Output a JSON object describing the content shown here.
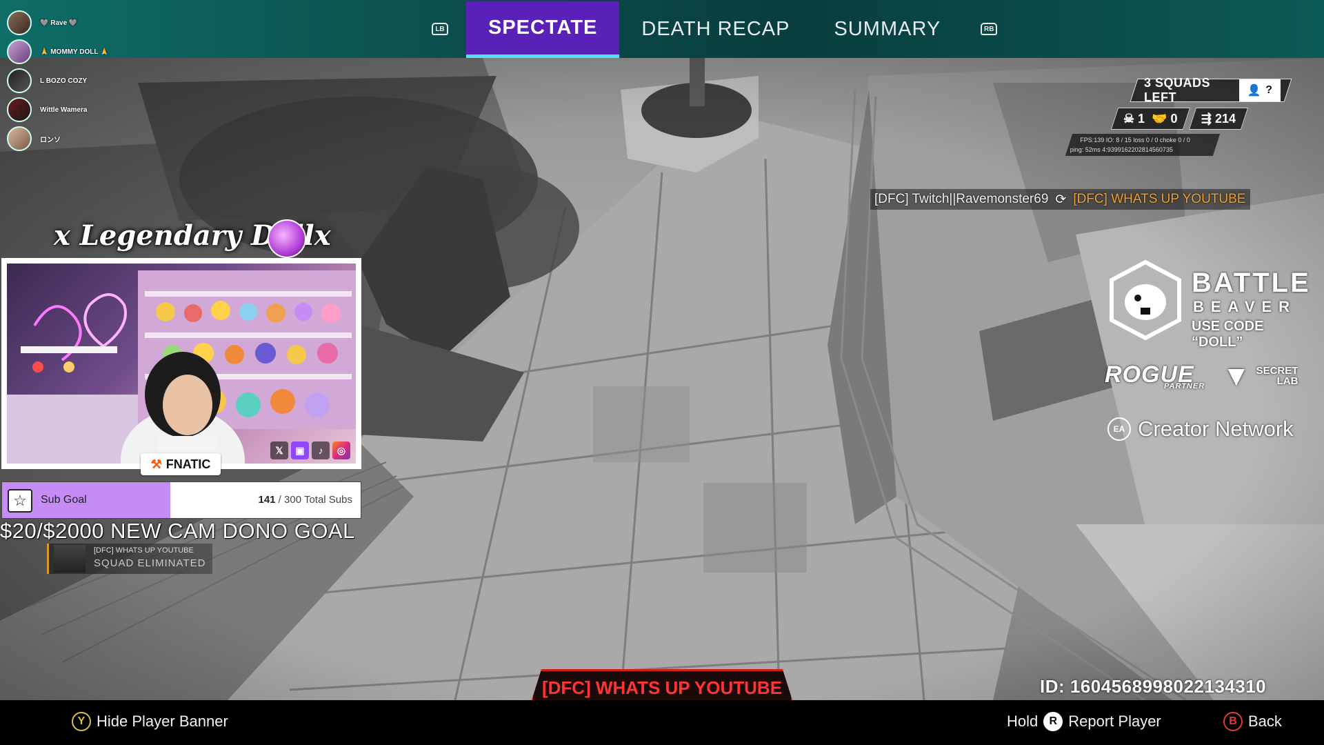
{
  "tabs": {
    "left_bumper": "LB",
    "right_bumper": "RB",
    "items": [
      {
        "label": "SPECTATE",
        "active": true
      },
      {
        "label": "DEATH RECAP",
        "active": false
      },
      {
        "label": "SUMMARY",
        "active": false
      }
    ]
  },
  "viewers": [
    "🩶 Rave 🩶",
    "🙏 MOMMY DOLL 🙏",
    "L BOZO COZY",
    "Wittle Wamera",
    "ロンソ"
  ],
  "stream": {
    "logo_text": "x Legendary Dollx",
    "team_tag": "FNATIC",
    "social_icons": [
      "x-icon",
      "twitch-icon",
      "tiktok-icon",
      "instagram-icon"
    ],
    "sub_goal": {
      "label": "Sub Goal",
      "current": "141",
      "separator": " / ",
      "target_text": "300 Total Subs",
      "progress": 0.47
    },
    "donation_goal": "$20/$2000 NEW CAM DONO GOAL"
  },
  "elimination": {
    "player": "[DFC] WHATS UP YOUTUBE",
    "status": "SQUAD ELIMINATED"
  },
  "match": {
    "squads_left": "3 SQUADS LEFT",
    "help": "?",
    "kills": "1",
    "assists": "0",
    "damage": "214",
    "net_line1": "FPS:139  IO: 8 / 15      loss 0 / 0  choke 0 / 0",
    "net_line2": "ping: 52ms      4:9399162202814560735"
  },
  "banner": {
    "killer": "[DFC] Twitch||Ravemonster69",
    "victim": "[DFC] WHATS UP YOUTUBE"
  },
  "sponsors": {
    "battle_top": "BATTLE",
    "battle_mid": "BEAVER",
    "battle_code": "USE CODE “DOLL”",
    "rogue": "ROGUE",
    "rogue_sub": "PARTNER",
    "secret_line1": "SECRET",
    "secret_line2": "LAB",
    "ea": "EA",
    "creator": "Creator Network"
  },
  "bottom": {
    "spectated_player": "[DFC] WHATS UP YOUTUBE",
    "player_id": "ID: 1604568998022134310",
    "hide_banner_key": "Y",
    "hide_banner_label": "Hide Player Banner",
    "report_hold": "Hold",
    "report_key": "R",
    "report_label": "Report Player",
    "back_key": "B",
    "back_label": "Back"
  },
  "colors": {
    "topbar": "#0b4a49",
    "active_tab": "#5a21b8",
    "tab_underline": "#4fe0ff",
    "sub_fill": "#c58cf5",
    "spectate_red": "#ff3434",
    "banner_orange": "#f5a02a"
  }
}
